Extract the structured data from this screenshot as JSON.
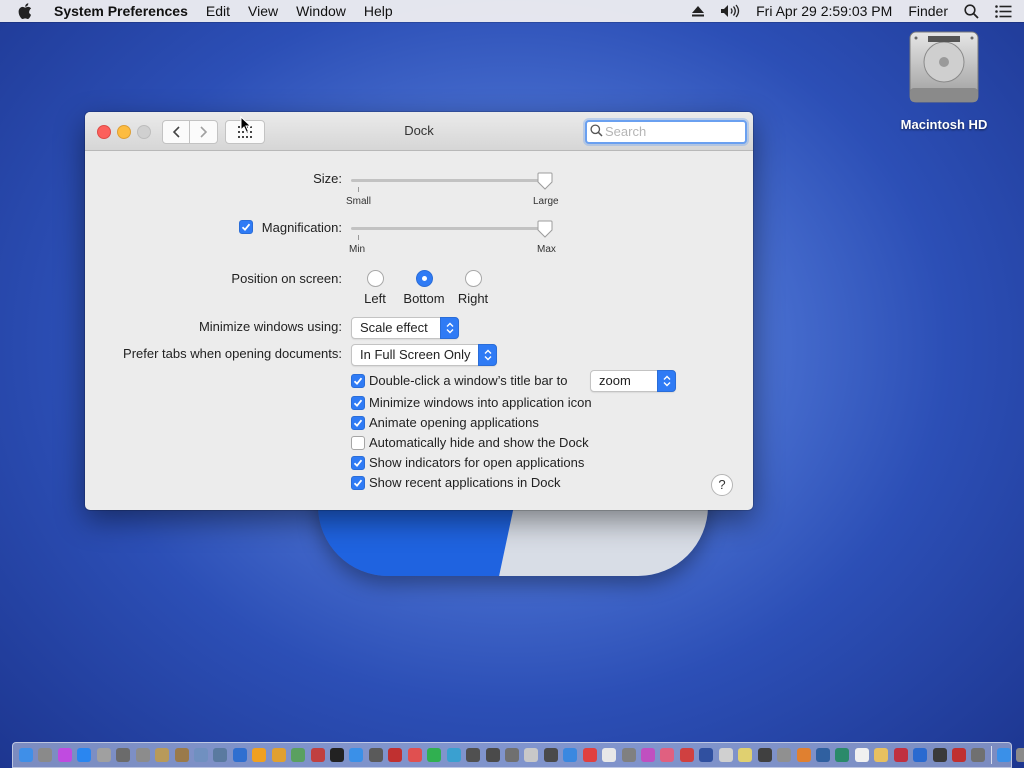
{
  "menubar": {
    "app_name": "System Preferences",
    "items": [
      "Edit",
      "View",
      "Window",
      "Help"
    ],
    "datetime": "Fri Apr 29  2:59:03 PM",
    "finder": "Finder"
  },
  "desktop": {
    "drive_label": "Macintosh HD"
  },
  "window": {
    "title": "Dock",
    "search_placeholder": "Search"
  },
  "dock_prefs": {
    "size": {
      "label": "Size:",
      "min_label": "Small",
      "max_label": "Large",
      "value": 1.0
    },
    "magnification": {
      "label": "Magnification:",
      "checked": true,
      "min_label": "Min",
      "max_label": "Max",
      "value": 1.0
    },
    "position": {
      "label": "Position on screen:",
      "options": [
        "Left",
        "Bottom",
        "Right"
      ],
      "selected": "Bottom"
    },
    "minimize": {
      "label": "Minimize windows using:",
      "value": "Scale effect"
    },
    "prefer_tabs": {
      "label": "Prefer tabs when opening documents:",
      "value": "In Full Screen Only"
    },
    "checkboxes": [
      {
        "label": "Double-click a window’s title bar to",
        "checked": true,
        "popup_value": "zoom"
      },
      {
        "label": "Minimize windows into application icon",
        "checked": true
      },
      {
        "label": "Animate opening applications",
        "checked": true
      },
      {
        "label": "Automatically hide and show the Dock",
        "checked": false
      },
      {
        "label": "Show indicators for open applications",
        "checked": true
      },
      {
        "label": "Show recent applications in Dock",
        "checked": true
      }
    ],
    "help": "?"
  },
  "dock_icon_colors": [
    "#3f8fe8",
    "#8a8a8a",
    "#c04be0",
    "#2a86f0",
    "#a0a0a0",
    "#6b6b6b",
    "#8c8c8c",
    "#b89a5a",
    "#9a7a4a",
    "#7090c0",
    "#5a7aa0",
    "#2f6fd0",
    "#f0a020",
    "#e0a030",
    "#5aa060",
    "#c04040",
    "#222222",
    "#3a90e8",
    "#5a5a5a",
    "#c03030",
    "#e05050",
    "#30b050",
    "#3aa0d0",
    "#505050",
    "#4a4a4a",
    "#707070",
    "#c8c8c8",
    "#4a4a4a",
    "#3a88e0",
    "#e04040",
    "#e8e8e8",
    "#808080",
    "#c050c0",
    "#e06080",
    "#d04040",
    "#3050a0",
    "#d0d0d0",
    "#e0d070",
    "#404040",
    "#909090",
    "#e08030",
    "#3060a0",
    "#2a8a6a",
    "#f0f0f0",
    "#e8c060",
    "#c03040",
    "#2a6ad0",
    "#3a3a3a",
    "#c03030",
    "#707070",
    "#3a90e8",
    "#8a8a8a"
  ]
}
